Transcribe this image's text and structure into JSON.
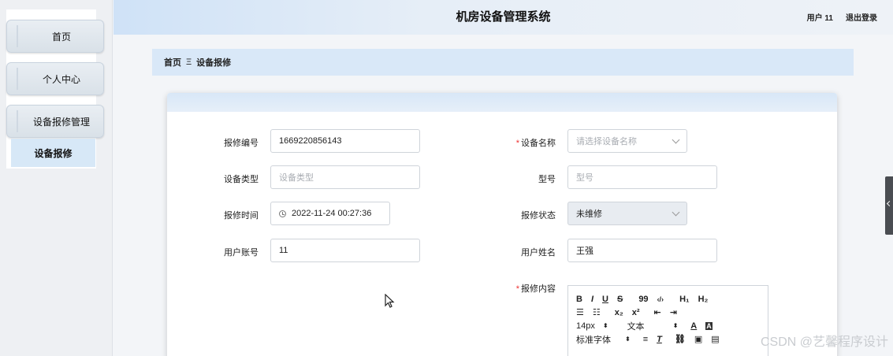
{
  "sidebar": {
    "items": [
      {
        "label": "首页"
      },
      {
        "label": "个人中心"
      },
      {
        "label": "设备报修管理"
      }
    ],
    "sub_item": "设备报修"
  },
  "header": {
    "title": "机房设备管理系统",
    "user": "用户 11",
    "logout": "退出登录"
  },
  "breadcrumb": {
    "home": "首页",
    "separator": "Ξ",
    "current": "设备报修"
  },
  "form": {
    "repair_no": {
      "label": "报修编号",
      "value": "1669220856143"
    },
    "device_name": {
      "label": "设备名称",
      "placeholder": "请选择设备名称"
    },
    "device_type": {
      "label": "设备类型",
      "placeholder": "设备类型"
    },
    "model": {
      "label": "型号",
      "placeholder": "型号"
    },
    "repair_time": {
      "label": "报修时间",
      "value": "2022-11-24 00:27:36"
    },
    "repair_status": {
      "label": "报修状态",
      "value": "未维修"
    },
    "user_account": {
      "label": "用户账号",
      "value": "11"
    },
    "user_name": {
      "label": "用户姓名",
      "value": "王强"
    },
    "repair_content": {
      "label": "报修内容"
    }
  },
  "editor": {
    "row1": [
      "B",
      "I",
      "U",
      "S",
      "99",
      "‹/›",
      "H₁",
      "H₂"
    ],
    "row2": [
      "☰",
      "☷",
      "x₂",
      "x²",
      "⇤",
      "⇥"
    ],
    "font_size": "14px",
    "text_style": "文本",
    "font_family": "标准字体"
  },
  "watermark": "CSDN @艺馨程序设计",
  "colors": {
    "accent": "#d9e8f8",
    "required": "#ee3333"
  }
}
